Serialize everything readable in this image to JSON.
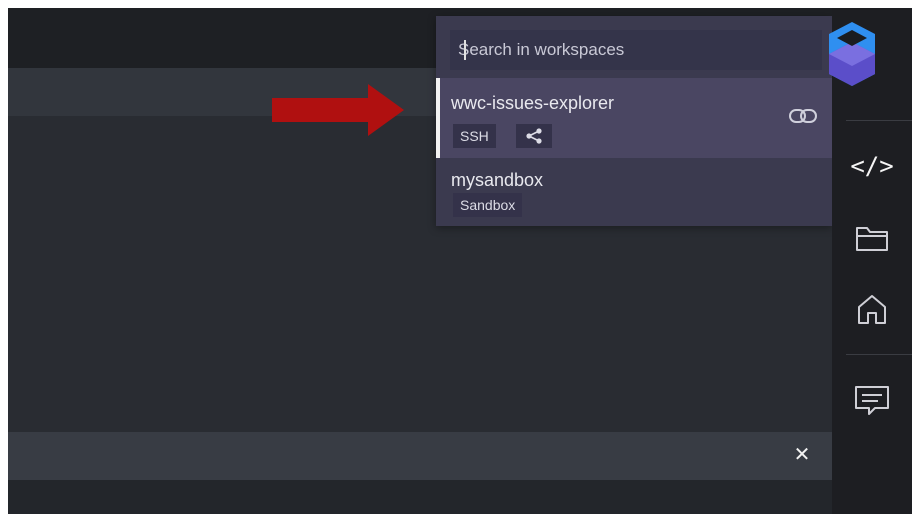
{
  "search": {
    "placeholder": "Search in workspaces"
  },
  "workspaces": [
    {
      "name": "wwc-issues-explorer",
      "tags": [
        "SSH"
      ],
      "selected": true
    },
    {
      "name": "mysandbox",
      "tags": [
        "Sandbox"
      ],
      "selected": false
    }
  ],
  "sidebar": {
    "items": [
      {
        "icon": "code-icon",
        "label": "</>"
      },
      {
        "icon": "folder-icon"
      },
      {
        "icon": "home-icon"
      },
      {
        "icon": "chat-icon"
      }
    ]
  },
  "bottom_panel": {
    "close_symbol": "✕"
  },
  "colors": {
    "arrow": "#b01010",
    "dropdown_bg": "#3b3a4f",
    "selected_bg": "#4a4662",
    "logo_blue": "#2f8ff0",
    "logo_purple": "#5b4ec9"
  }
}
